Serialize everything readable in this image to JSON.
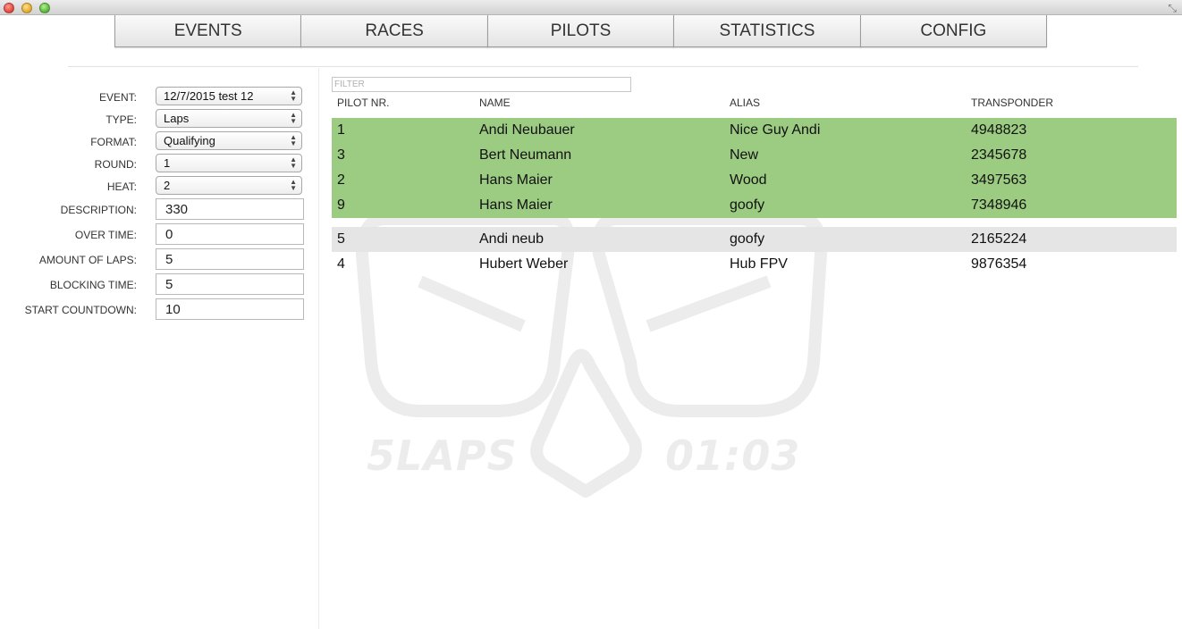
{
  "window": {
    "fullscreen_icon": "fullscreen-arrows-icon"
  },
  "nav": {
    "tabs": [
      {
        "label": "EVENTS"
      },
      {
        "label": "RACES"
      },
      {
        "label": "PILOTS"
      },
      {
        "label": "STATISTICS"
      },
      {
        "label": "CONFIG"
      }
    ]
  },
  "form": {
    "event": {
      "label": "EVENT:",
      "value": "12/7/2015 test 12"
    },
    "type": {
      "label": "TYPE:",
      "value": "Laps"
    },
    "format": {
      "label": "FORMAT:",
      "value": "Qualifying"
    },
    "round": {
      "label": "ROUND:",
      "value": "1"
    },
    "heat": {
      "label": "HEAT:",
      "value": "2"
    },
    "description": {
      "label": "DESCRIPTION:",
      "value": "330"
    },
    "over_time": {
      "label": "OVER TIME:",
      "value": "0"
    },
    "amount_of_laps": {
      "label": "AMOUNT OF LAPS:",
      "value": "5"
    },
    "blocking_time": {
      "label": "BLOCKING TIME:",
      "value": "5"
    },
    "start_countdown": {
      "label": "START COUNTDOWN:",
      "value": "10"
    }
  },
  "table": {
    "filter_placeholder": "FILTER",
    "headers": {
      "pilot_nr": "PILOT NR.",
      "name": "NAME",
      "alias": "ALIAS",
      "transponder": "TRANSPONDER"
    },
    "selected_rows": [
      {
        "nr": "1",
        "name": "Andi Neubauer",
        "alias": "Nice Guy Andi",
        "transponder": "4948823"
      },
      {
        "nr": "3",
        "name": "Bert Neumann",
        "alias": "New",
        "transponder": "2345678"
      },
      {
        "nr": "2",
        "name": "Hans Maier",
        "alias": "Wood",
        "transponder": "3497563"
      },
      {
        "nr": "9",
        "name": "Hans Maier",
        "alias": "goofy",
        "transponder": "7348946"
      }
    ],
    "other_rows": [
      {
        "nr": "5",
        "name": "Andi neub",
        "alias": "goofy",
        "transponder": "2165224"
      },
      {
        "nr": "4",
        "name": "Hubert Weber",
        "alias": "Hub FPV",
        "transponder": "9876354"
      }
    ]
  },
  "watermark": {
    "brand": "5LAPS",
    "time": "01:03"
  },
  "colors": {
    "selected_row": "#9ccb82",
    "alt_row": "#e5e5e5"
  }
}
